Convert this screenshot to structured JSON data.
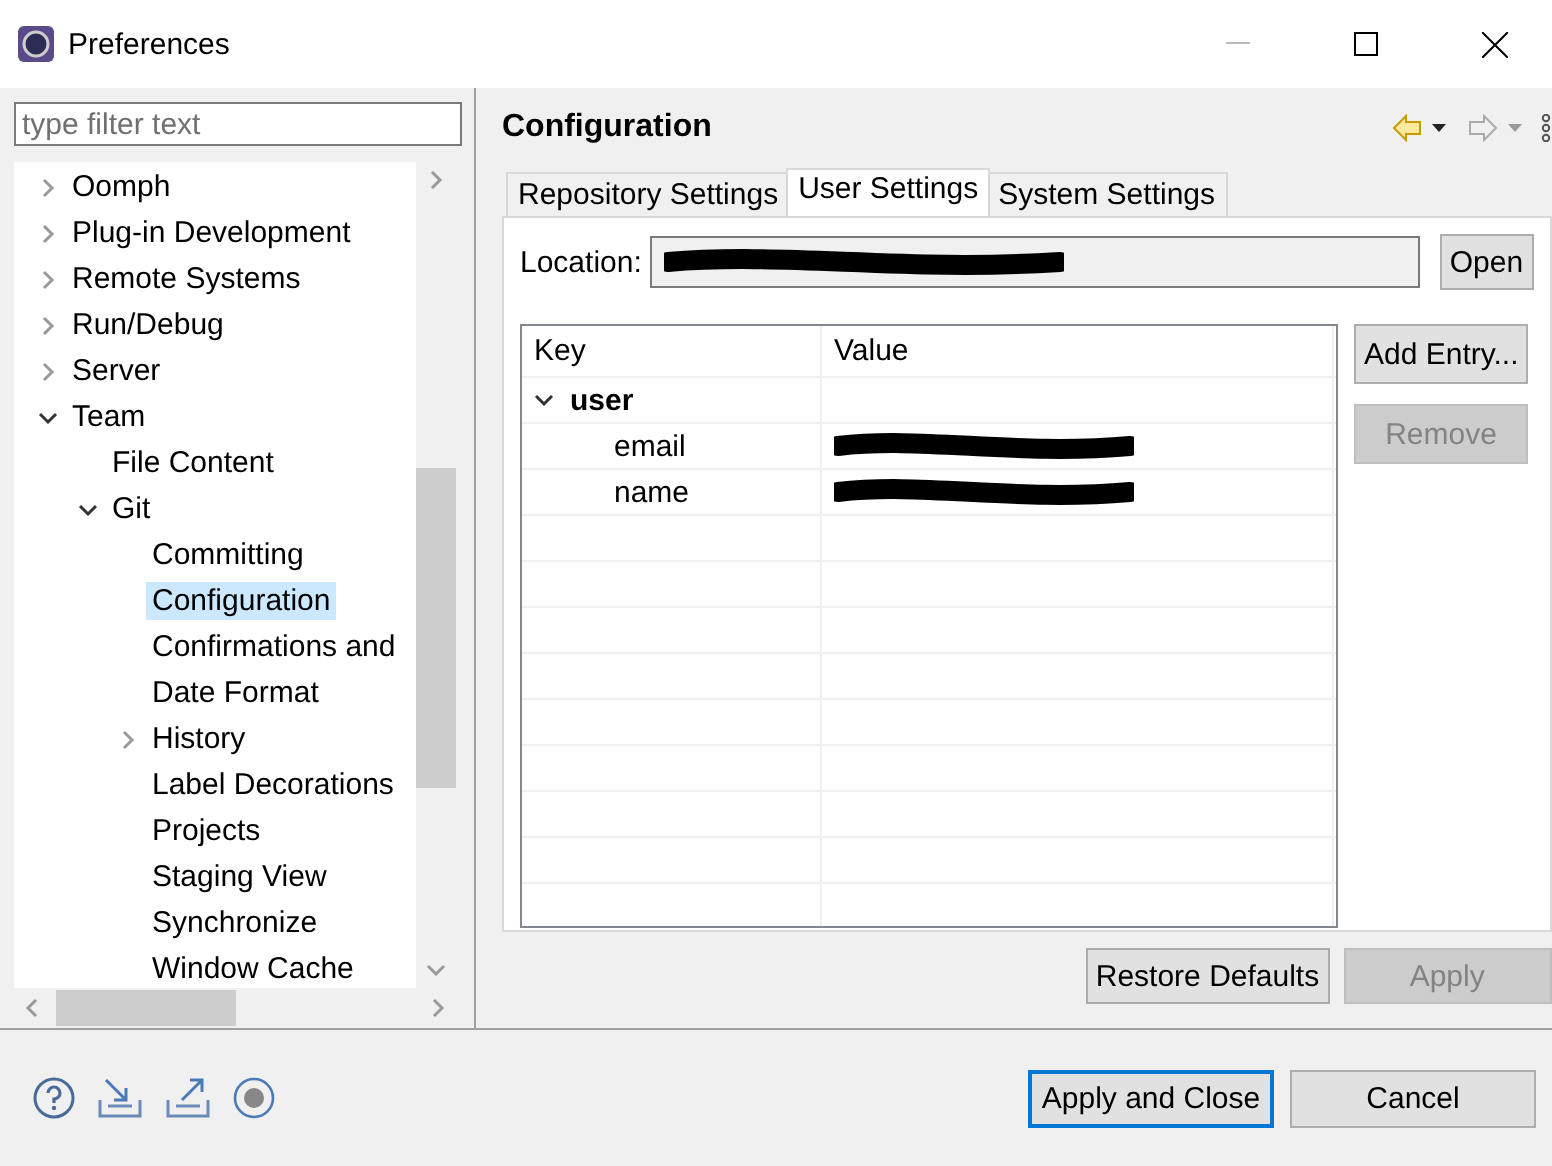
{
  "window": {
    "title": "Preferences"
  },
  "filter": {
    "placeholder": "type filter text"
  },
  "tree": [
    {
      "label": "Oomph",
      "expanded": false,
      "selected": false
    },
    {
      "label": "Plug-in Development",
      "expanded": false,
      "selected": false
    },
    {
      "label": "Remote Systems",
      "expanded": false,
      "selected": false
    },
    {
      "label": "Run/Debug",
      "expanded": false,
      "selected": false
    },
    {
      "label": "Server",
      "expanded": false,
      "selected": false
    },
    {
      "label": "Team",
      "expanded": true,
      "selected": false,
      "children": [
        {
          "label": "File Content",
          "selected": false
        },
        {
          "label": "Git",
          "expanded": true,
          "selected": false,
          "children": [
            {
              "label": "Committing",
              "selected": false
            },
            {
              "label": "Configuration",
              "selected": true
            },
            {
              "label": "Confirmations and",
              "selected": false
            },
            {
              "label": "Date Format",
              "selected": false
            },
            {
              "label": "History",
              "expanded": false,
              "selected": false
            },
            {
              "label": "Label Decorations",
              "selected": false
            },
            {
              "label": "Projects",
              "selected": false
            },
            {
              "label": "Staging View",
              "selected": false
            },
            {
              "label": "Synchronize",
              "selected": false
            },
            {
              "label": "Window Cache",
              "selected": false
            }
          ]
        }
      ]
    }
  ],
  "page": {
    "title": "Configuration"
  },
  "tabs": [
    {
      "label": "Repository Settings",
      "selected": false
    },
    {
      "label": "User Settings",
      "selected": true
    },
    {
      "label": "System Settings",
      "selected": false
    }
  ],
  "location": {
    "label": "Location:",
    "button": "Open"
  },
  "table": {
    "columns": [
      "Key",
      "Value"
    ],
    "section": {
      "label": "user",
      "expanded": true
    },
    "rows": [
      {
        "key": "email"
      },
      {
        "key": "name"
      }
    ]
  },
  "side_buttons": [
    {
      "label": "Add Entry...",
      "disabled": false
    },
    {
      "label": "Remove",
      "disabled": true
    }
  ],
  "page_buttons": [
    {
      "label": "Restore Defaults",
      "disabled": false
    },
    {
      "label": "Apply",
      "disabled": true
    }
  ],
  "dialog_buttons": [
    {
      "label": "Apply and Close",
      "default": true
    },
    {
      "label": "Cancel",
      "default": false
    }
  ]
}
